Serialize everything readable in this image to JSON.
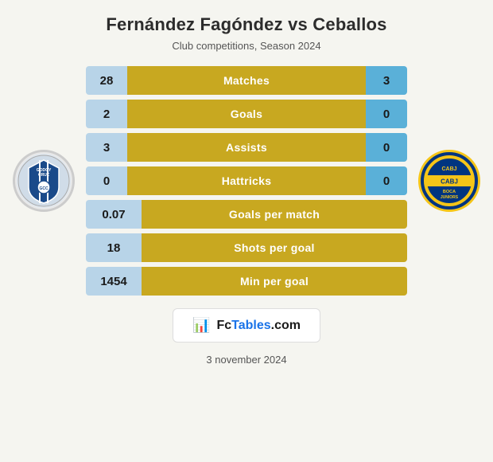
{
  "header": {
    "title": "Fernández Fagóndez vs Ceballos",
    "subtitle": "Club competitions, Season 2024"
  },
  "stats": [
    {
      "id": "matches",
      "label": "Matches",
      "left": "28",
      "right": "3",
      "single": false
    },
    {
      "id": "goals",
      "label": "Goals",
      "left": "2",
      "right": "0",
      "single": false
    },
    {
      "id": "assists",
      "label": "Assists",
      "left": "3",
      "right": "0",
      "single": false
    },
    {
      "id": "hattricks",
      "label": "Hattricks",
      "left": "0",
      "right": "0",
      "single": false
    },
    {
      "id": "goals-per-match",
      "label": "Goals per match",
      "left": "0.07",
      "right": null,
      "single": true
    },
    {
      "id": "shots-per-goal",
      "label": "Shots per goal",
      "left": "18",
      "right": null,
      "single": true
    },
    {
      "id": "min-per-goal",
      "label": "Min per goal",
      "left": "1454",
      "right": null,
      "single": true
    }
  ],
  "fctables": {
    "text": "FcTables.com"
  },
  "footer": {
    "date": "3 november 2024"
  }
}
